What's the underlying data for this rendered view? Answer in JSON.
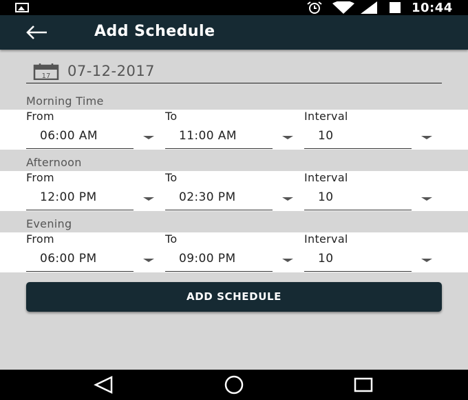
{
  "status_bar": {
    "time": "10:44",
    "icons": [
      "picture-icon",
      "alarm-icon",
      "wifi-icon",
      "signal-icon",
      "battery-icon"
    ]
  },
  "app_bar": {
    "title": "Add Schedule",
    "back_icon": "arrow-left-icon"
  },
  "date": {
    "value": "07-12-2017",
    "icon": "calendar-icon"
  },
  "sections": [
    {
      "label": "Morning Time",
      "from_label": "From",
      "to_label": "To",
      "interval_label": "Interval",
      "from": "06:00 AM",
      "to": "11:00 AM",
      "interval": "10"
    },
    {
      "label": "Afternoon",
      "from_label": "From",
      "to_label": "To",
      "interval_label": "Interval",
      "from": "12:00 PM",
      "to": "02:30 PM",
      "interval": "10"
    },
    {
      "label": "Evening",
      "from_label": "From",
      "to_label": "To",
      "interval_label": "Interval",
      "from": "06:00 PM",
      "to": "09:00 PM",
      "interval": "10"
    }
  ],
  "add_button": {
    "label": "ADD SCHEDULE"
  },
  "nav_bar": {
    "icons": [
      "back-triangle-icon",
      "home-circle-icon",
      "recents-square-icon"
    ]
  },
  "colors": {
    "primary": "#162a33",
    "background": "#d6d6d6"
  }
}
